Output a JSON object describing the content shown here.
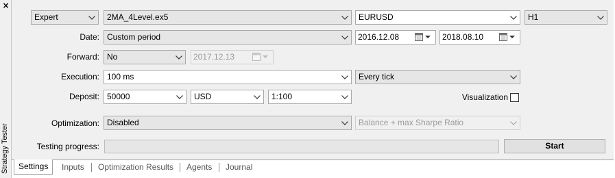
{
  "window": {
    "title": "Strategy Tester",
    "close_glyph": "×"
  },
  "settings": {
    "mode": "Expert",
    "expert_file": "2MA_4Level.ex5",
    "symbol": "EURUSD",
    "timeframe": "H1",
    "date_label": "Date:",
    "date_mode": "Custom period",
    "date_from": "2016.12.08",
    "date_to": "2018.08.10",
    "forward_label": "Forward:",
    "forward_value": "No",
    "forward_date": "2017.12.13",
    "execution_label": "Execution:",
    "execution_delay": "100 ms",
    "tick_model": "Every tick",
    "deposit_label": "Deposit:",
    "deposit_amount": "50000",
    "deposit_currency": "USD",
    "leverage": "1:100",
    "visualization_label": "Visualization",
    "visualization_checked": false,
    "optimization_label": "Optimization:",
    "optimization_value": "Disabled",
    "optimization_criterion": "Balance + max Sharpe Ratio",
    "progress_label": "Testing progress:",
    "progress_value": 0,
    "start_label": "Start"
  },
  "tabs": [
    {
      "label": "Settings",
      "active": true
    },
    {
      "label": "Inputs",
      "active": false
    },
    {
      "label": "Optimization Results",
      "active": false
    },
    {
      "label": "Agents",
      "active": false
    },
    {
      "label": "Journal",
      "active": false
    }
  ],
  "icons": {
    "dropdown": "chevron-down-icon",
    "calendar": "calendar-icon",
    "close": "close-icon"
  },
  "colors": {
    "panel_bg": "#f0f0f0",
    "border": "#a9a9a9",
    "disabled_text": "#9a9a9a",
    "button_bg": "#e1e1e1"
  }
}
